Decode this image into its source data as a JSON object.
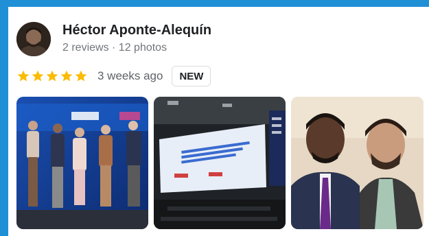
{
  "reviewer": {
    "name": "Héctor Aponte-Alequín",
    "meta": "2 reviews · 12 photos"
  },
  "review": {
    "stars": 5,
    "time": "3 weeks ago",
    "badge": "NEW"
  },
  "photos": [
    {
      "subject": "group-photo-on-stage"
    },
    {
      "subject": "conference-presentation-screen"
    },
    {
      "subject": "selfie-two-people"
    }
  ],
  "colors": {
    "frame": "#1f8fd6",
    "star": "#fbbc04",
    "text": "#202124",
    "secondary": "#70757a"
  }
}
